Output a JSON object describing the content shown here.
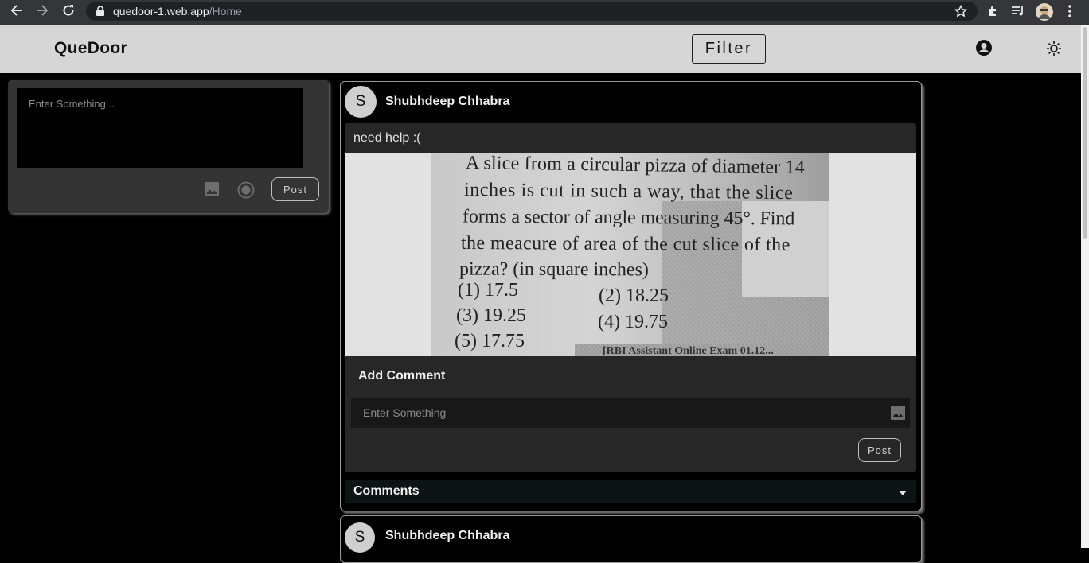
{
  "browser": {
    "url_host": "quedoor-1.web.app",
    "url_path": "/Home"
  },
  "header": {
    "brand": "QueDoor",
    "filter_label": "Filter"
  },
  "composer": {
    "placeholder": "Enter Something...",
    "post_label": "Post"
  },
  "posts": [
    {
      "avatar_letter": "S",
      "author": "Shubhdeep Chhabra",
      "text": "need help :(",
      "image_text": {
        "line1": "A slice from a circular pizza of diameter 14",
        "line2": "inches is cut in such a way, that the slice",
        "line3": "forms a sector of angle measuring 45°. Find",
        "line4": "the meacure of area of the cut slice of the",
        "line5": "pizza? (in square inches)",
        "opt1": "(1) 17.5",
        "opt2": "(2) 18.25",
        "opt3": "(3) 19.25",
        "opt4": "(4) 19.75",
        "opt5": "(5) 17.75",
        "source": "[RBI Assistant Online Exam 01.12..."
      },
      "add_comment_title": "Add Comment",
      "comment_placeholder": "Enter Something",
      "comment_post_label": "Post",
      "comments_label": "Comments"
    },
    {
      "avatar_letter": "S",
      "author": "Shubhdeep Chhabra"
    }
  ]
}
